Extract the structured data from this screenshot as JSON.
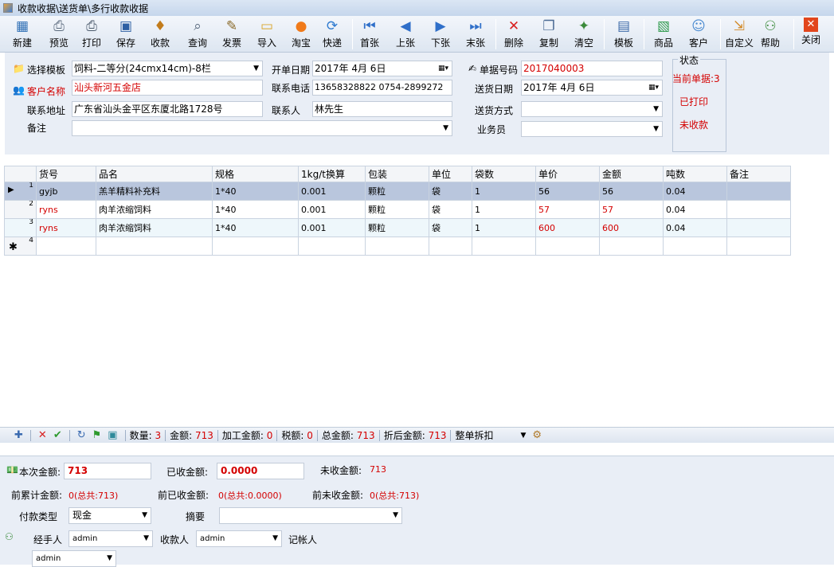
{
  "window": {
    "title": "收款收据\\送货单\\多行收款收据"
  },
  "toolbar": {
    "new": "新建",
    "preview": "预览",
    "print": "打印",
    "save": "保存",
    "receive": "收款",
    "query": "查询",
    "invoice": "发票",
    "import": "导入",
    "taobao": "淘宝",
    "express": "快递",
    "first": "首张",
    "prev": "上张",
    "next": "下张",
    "last": "末张",
    "delete": "删除",
    "copy": "复制",
    "clear": "清空",
    "template": "模板",
    "goods": "商品",
    "customer": "客户",
    "custom": "自定义",
    "help": "帮助",
    "close": "关闭"
  },
  "form": {
    "template_label": "选择模板",
    "template_value": "饲料-二等分(24cmx14cm)-8栏",
    "open_date_label": "开单日期",
    "open_date_value": "2017年 4月 6日",
    "doc_no_label": "单据号码",
    "doc_no_value": "2017040003",
    "customer_label": "客户名称",
    "customer_value": "汕头新河五金店",
    "phone_label": "联系电话",
    "phone_value": "13658328822 0754-2899272",
    "ship_date_label": "送货日期",
    "ship_date_value": "2017年 4月 6日",
    "address_label": "联系地址",
    "address_value": "广东省汕头金平区东厦北路1728号",
    "contact_label": "联系人",
    "contact_value": "林先生",
    "ship_method_label": "送货方式",
    "ship_method_value": "",
    "note_label": "备注",
    "note_value": "",
    "salesman_label": "业务员",
    "salesman_value": "",
    "status": {
      "title": "状态",
      "current": "当前单据:3",
      "printed": "已打印",
      "unpaid": "未收款"
    }
  },
  "grid": {
    "columns": [
      "货号",
      "品名",
      "规格",
      "1kg/t换算",
      "包装",
      "单位",
      "袋数",
      "单价",
      "金额",
      "吨数",
      "备注"
    ],
    "rows": [
      {
        "num": "1",
        "cells": [
          "gyjb",
          "羔羊精料补充料",
          "1*40",
          "0.001",
          "颗粒",
          "袋",
          "1",
          "56",
          "56",
          "0.04",
          ""
        ]
      },
      {
        "num": "2",
        "cells": [
          "ryns",
          "肉羊浓缩饲料",
          "1*40",
          "0.001",
          "颗粒",
          "袋",
          "1",
          "57",
          "57",
          "0.04",
          ""
        ]
      },
      {
        "num": "3",
        "cells": [
          "ryns",
          "肉羊浓缩饲料",
          "1*40",
          "0.001",
          "颗粒",
          "袋",
          "1",
          "600",
          "600",
          "0.04",
          ""
        ]
      },
      {
        "num": "4",
        "cells": [
          "",
          "",
          "",
          "",
          "",
          "",
          "",
          "",
          "",
          "",
          ""
        ]
      }
    ]
  },
  "summary": {
    "qty_label": "数量:",
    "qty": "3",
    "amount_label": "金额:",
    "amount": "713",
    "proc_label": "加工金额:",
    "proc": "0",
    "tax_label": "税额:",
    "tax": "0",
    "total_label": "总金额:",
    "total": "713",
    "disc_label": "折后金额:",
    "disc": "713",
    "whole_label": "整单拆扣"
  },
  "payment": {
    "this_amount_label": "本次金额:",
    "this_amount": "713",
    "received_label": "已收金额:",
    "received": "0.0000",
    "unreceived_label": "未收金额:",
    "unreceived": "713",
    "prev_total_label": "前累计金额:",
    "prev_total": "0(总共:713)",
    "prev_received_label": "前已收金额:",
    "prev_received": "0(总共:0.0000)",
    "prev_unreceived_label": "前未收金额:",
    "prev_unreceived": "0(总共:713)",
    "pay_type_label": "付款类型",
    "pay_type": "现金",
    "summary_label": "摘要",
    "summary": "",
    "handler_label": "经手人",
    "handler": "admin",
    "payee_label": "收款人",
    "payee": "admin",
    "bookkeeper_label": "记帐人",
    "bookkeeper": "admin"
  }
}
